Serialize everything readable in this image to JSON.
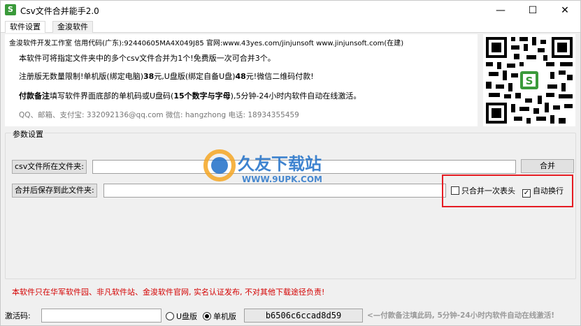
{
  "window": {
    "title": "Csv文件合并能手2.0",
    "icon_letter": "S",
    "controls": {
      "minimize": "—",
      "maximize": "☐",
      "close": "✕"
    }
  },
  "tabs": [
    {
      "label": "软件设置"
    },
    {
      "label": "金浚软件"
    }
  ],
  "info": {
    "header": "金浚软件开发工作室 信用代码(广东):92440605MA4X049J85 官网:www.43yes.com/jinjunsoft  www.jinjunsoft.com(在建)",
    "line1": "本软件可将指定文件夹中的多个csv文件合并为1个!免费版一次可合并3个。",
    "line2_a": "注册版无数量限制!单机版(绑定电脑)",
    "line2_b": "38",
    "line2_c": "元,U盘版(绑定自备U盘)",
    "line2_d": "48",
    "line2_e": "元!微信二维码付款!",
    "line3_a": "付款备注",
    "line3_b": "填写软件界面底部的单机码或U盘码(",
    "line3_c": "15个数字与字母",
    "line3_d": "),5分钟-24小时内软件自动在线激活。",
    "contact": "QQ、邮箱、支付宝: 332092136@qq.com   微信: hangzhong   电话: 18934355459"
  },
  "params": {
    "group_title": "参数设置",
    "csv_folder_label": "csv文件所在文件夹:",
    "csv_folder_value": "",
    "merge_button": "合并",
    "save_folder_label": "合并后保存到此文件夹:",
    "save_folder_value": "",
    "only_once_header": {
      "label": "只合并一次表头",
      "checked": false
    },
    "auto_wrap": {
      "label": "自动换行",
      "checked": true
    }
  },
  "watermark": {
    "brand": "久友下载站",
    "url": "WWW.9UPK.COM"
  },
  "footer": {
    "notice": "本软件只在华军软件园、非凡软件站、金浚软件官网, 实名认证发布, 不对其他下载途径负责!",
    "activation_label": "激活码:",
    "activation_value": "",
    "usb_label": "U盘版",
    "usb_selected": false,
    "single_label": "单机版",
    "single_selected": true,
    "machine_code": "b6506c6ccad8d59",
    "hint": "<—付款备注填此码, 5分钟-24小时内软件自动在线激活!"
  },
  "colors": {
    "accent_red": "#e51c23",
    "notice_red": "#d40000",
    "icon_green": "#3a9a3a"
  }
}
